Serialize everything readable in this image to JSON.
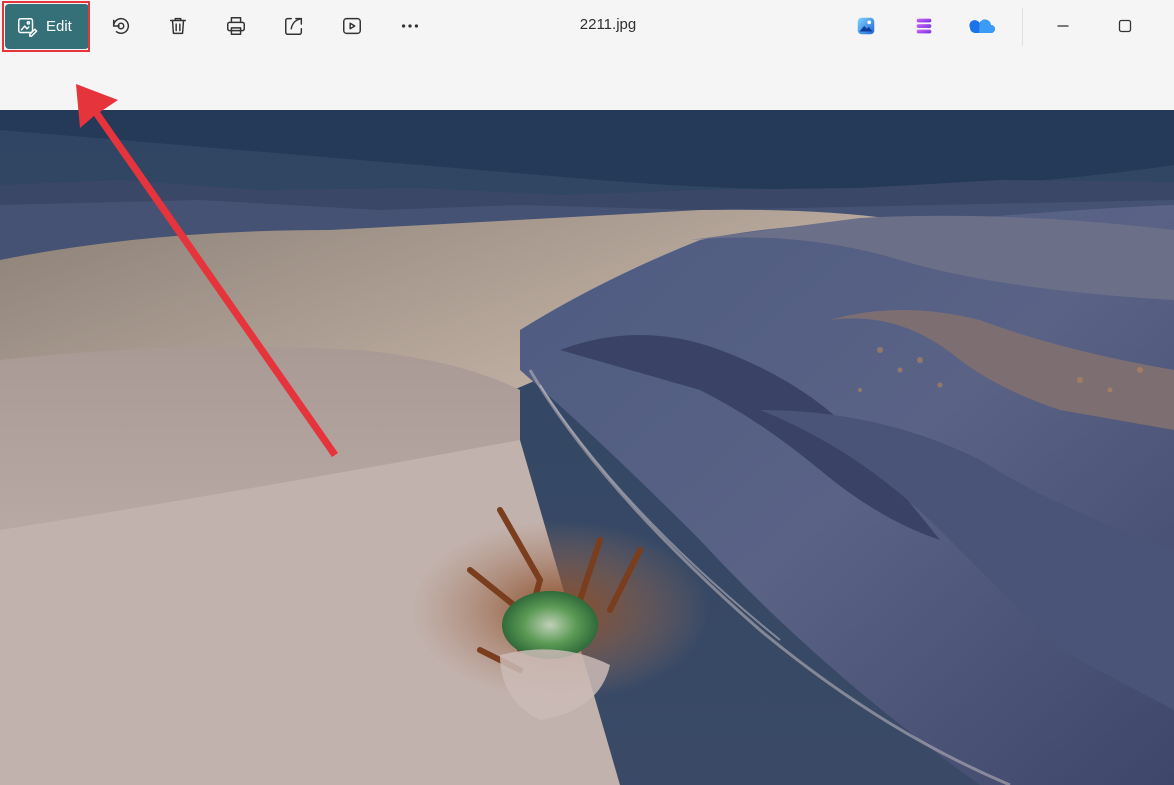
{
  "window": {
    "title": "2211.jpg"
  },
  "toolbar": {
    "edit_label": "Edit",
    "icons": [
      "edit-icon",
      "rotate-icon",
      "delete-icon",
      "print-icon",
      "share-icon",
      "slideshow-icon",
      "more-icon"
    ]
  },
  "apps": {
    "icons": [
      "photos-app-icon",
      "clipchamp-icon",
      "onedrive-icon"
    ]
  },
  "window_controls": {
    "icons": [
      "minimize-icon",
      "maximize-icon"
    ]
  },
  "colors": {
    "edit_button": "#356f78",
    "highlight": "#e5343b",
    "arrow": "#e5343b",
    "toolbar_bg": "#f5f5f5"
  }
}
